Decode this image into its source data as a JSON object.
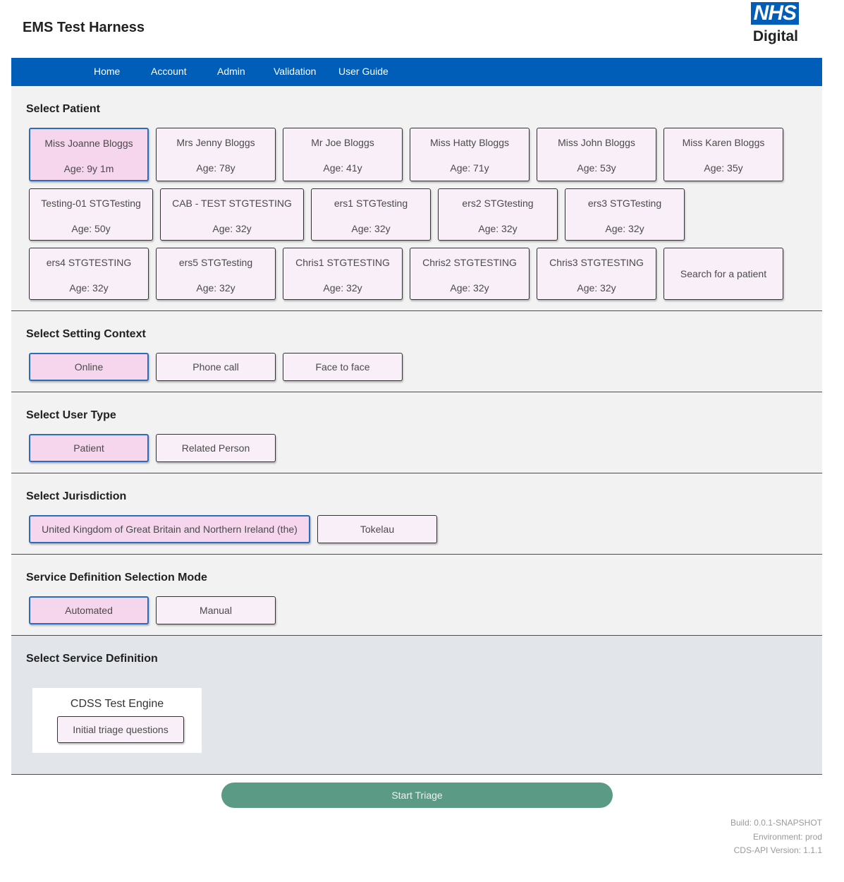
{
  "header": {
    "title": "EMS Test Harness",
    "logo_badge": "NHS",
    "logo_sub": "Digital"
  },
  "nav": {
    "items": [
      "Home",
      "Account",
      "Admin",
      "Validation",
      "User Guide"
    ]
  },
  "patients": {
    "title": "Select Patient",
    "items": [
      {
        "name": "Miss Joanne Bloggs",
        "age": "Age: 9y 1m",
        "selected": true
      },
      {
        "name": "Mrs Jenny Bloggs",
        "age": "Age: 78y"
      },
      {
        "name": "Mr Joe Bloggs",
        "age": "Age: 41y"
      },
      {
        "name": "Miss Hatty Bloggs",
        "age": "Age: 71y"
      },
      {
        "name": "Miss John Bloggs",
        "age": "Age: 53y"
      },
      {
        "name": "Miss Karen Bloggs",
        "age": "Age: 35y"
      },
      {
        "name": "Testing-01 STGTesting",
        "age": "Age: 50y"
      },
      {
        "name": "CAB - TEST STGTESTING",
        "age": "Age: 32y"
      },
      {
        "name": "ers1 STGTesting",
        "age": "Age: 32y"
      },
      {
        "name": "ers2 STGtesting",
        "age": "Age: 32y"
      },
      {
        "name": "ers3 STGTesting",
        "age": "Age: 32y"
      },
      {
        "name": "ers4 STGTESTING",
        "age": "Age: 32y"
      },
      {
        "name": "ers5 STGTesting",
        "age": "Age: 32y"
      },
      {
        "name": "Chris1 STGTESTING",
        "age": "Age: 32y"
      },
      {
        "name": "Chris2 STGTESTING",
        "age": "Age: 32y"
      },
      {
        "name": "Chris3 STGTESTING",
        "age": "Age: 32y"
      }
    ],
    "search_label": "Search for a patient"
  },
  "setting_context": {
    "title": "Select Setting Context",
    "options": [
      "Online",
      "Phone call",
      "Face to face"
    ],
    "selected": "Online"
  },
  "user_type": {
    "title": "Select User Type",
    "options": [
      "Patient",
      "Related Person"
    ],
    "selected": "Patient"
  },
  "jurisdiction": {
    "title": "Select Jurisdiction",
    "options": [
      "United Kingdom of Great Britain and Northern Ireland (the)",
      "Tokelau"
    ],
    "selected": "United Kingdom of Great Britain and Northern Ireland (the)"
  },
  "sd_mode": {
    "title": "Service Definition Selection Mode",
    "options": [
      "Automated",
      "Manual"
    ],
    "selected": "Automated"
  },
  "service_definition": {
    "title": "Select Service Definition",
    "card_title": "CDSS Test Engine",
    "button": "Initial triage questions"
  },
  "start_button": "Start Triage",
  "footer": {
    "build": "Build: 0.0.1-SNAPSHOT",
    "environment": "Environment: prod",
    "api_version": "CDS-API Version: 1.1.1"
  }
}
